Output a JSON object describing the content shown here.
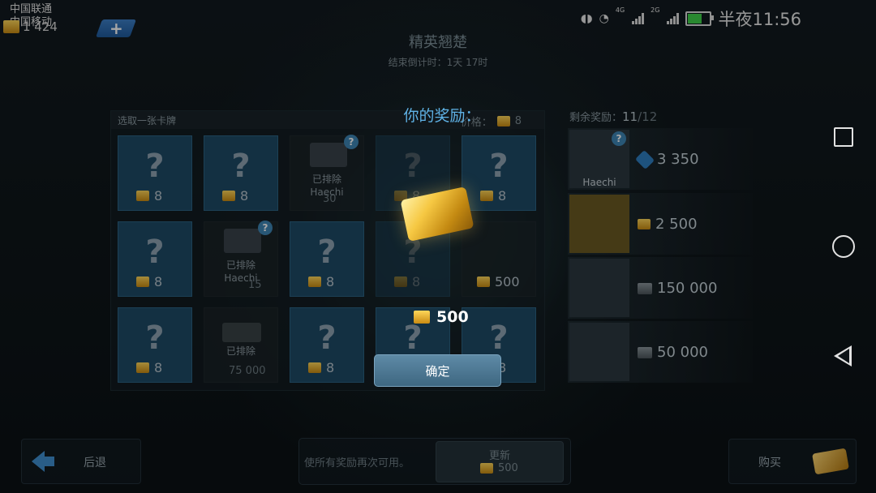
{
  "status_bar": {
    "carrier1": "中国联通",
    "carrier2": "中国移动",
    "net1": "4G",
    "net2": "2G",
    "time": "半夜11:56"
  },
  "currency": {
    "amount": "1 424",
    "icon": "gold-bar-icon"
  },
  "header": {
    "title": "精英翘楚",
    "countdown": "结束倒计时：1天 17时"
  },
  "panel": {
    "title": "选取一张卡牌",
    "cost_label": "价格：",
    "cost_value": "8"
  },
  "cards": {
    "c1": {
      "cost": "8"
    },
    "c2": {
      "cost": "8"
    },
    "c3": {
      "status": "已排除",
      "name": "Haechi",
      "cost": "30"
    },
    "c4": {
      "cost": "8"
    },
    "c5": {
      "cost": "8"
    },
    "c6": {
      "cost": "8"
    },
    "c7": {
      "status": "已排除",
      "name": "Haechi",
      "cost": "15"
    },
    "c8": {
      "cost": "8"
    },
    "c9": {
      "cost": "8"
    },
    "c10": {
      "cost": "500"
    },
    "c11": {
      "cost": "8"
    },
    "c12": {
      "status": "已排除",
      "cost": "75 000"
    },
    "c13": {
      "cost": "8"
    },
    "c14": {
      "cost": "8"
    },
    "c15": {
      "cost": "8"
    },
    "question_mark": "?"
  },
  "popup": {
    "title": "你的奖励：",
    "amount": "500",
    "confirm_label": "确定"
  },
  "rewards_list": {
    "label": "剩余奖励：",
    "remaining": "11",
    "total": "/12",
    "items": [
      {
        "name": "Haechi",
        "value": "3 350",
        "currency_icon": "blueprint-icon"
      },
      {
        "value": "2 500",
        "currency_icon": "gold-bar-icon"
      },
      {
        "value": "150 000",
        "currency_icon": "silver-icon"
      },
      {
        "value": "50 000",
        "currency_icon": "silver-icon"
      }
    ]
  },
  "bottom": {
    "back_label": "后退",
    "refresh_note": "使所有奖励再次可用。",
    "refresh_label": "更新",
    "refresh_cost": "500",
    "buy_label": "购买"
  },
  "colors": {
    "accent_blue": "#5fb2e6",
    "gold": "#f6c843",
    "card_blue": "#1e4a66"
  }
}
